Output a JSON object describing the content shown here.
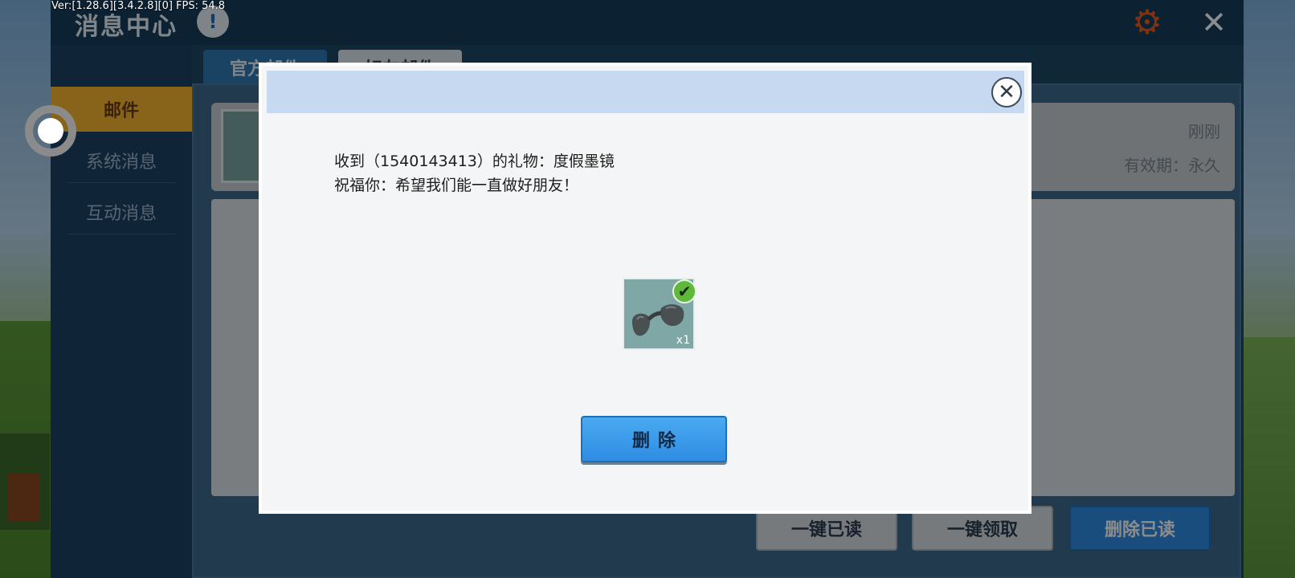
{
  "hud": {
    "version_text": "Ver:[1.28.6][3.4.2.8][0] FPS: 54.8"
  },
  "header": {
    "title": "消息中心",
    "info_icon": "!",
    "gear_icon": "⚙",
    "close_icon": "✕"
  },
  "sidebar": {
    "items": [
      {
        "label": "邮件",
        "active": true
      },
      {
        "label": "系统消息",
        "active": false
      },
      {
        "label": "互动消息",
        "active": false
      }
    ]
  },
  "tabs": [
    {
      "label": "官方邮件"
    },
    {
      "label": "好友邮件"
    }
  ],
  "mail": {
    "time": "刚刚",
    "expire": "有效期：永久"
  },
  "bottom_buttons": {
    "read_all": "一键已读",
    "claim_all": "一键领取",
    "delete_read": "删除已读"
  },
  "modal": {
    "close_icon": "✕",
    "line1": "收到（1540143413）的礼物：度假墨镜",
    "line2": "祝福你：希望我们能一直做好朋友！",
    "gift_count": "x1",
    "check_icon": "✔",
    "delete_label": "删除"
  },
  "colors": {
    "accent_blue": "#2f8de3",
    "sidebar_active": "#f7b731",
    "modal_header": "#c6d9f0"
  }
}
